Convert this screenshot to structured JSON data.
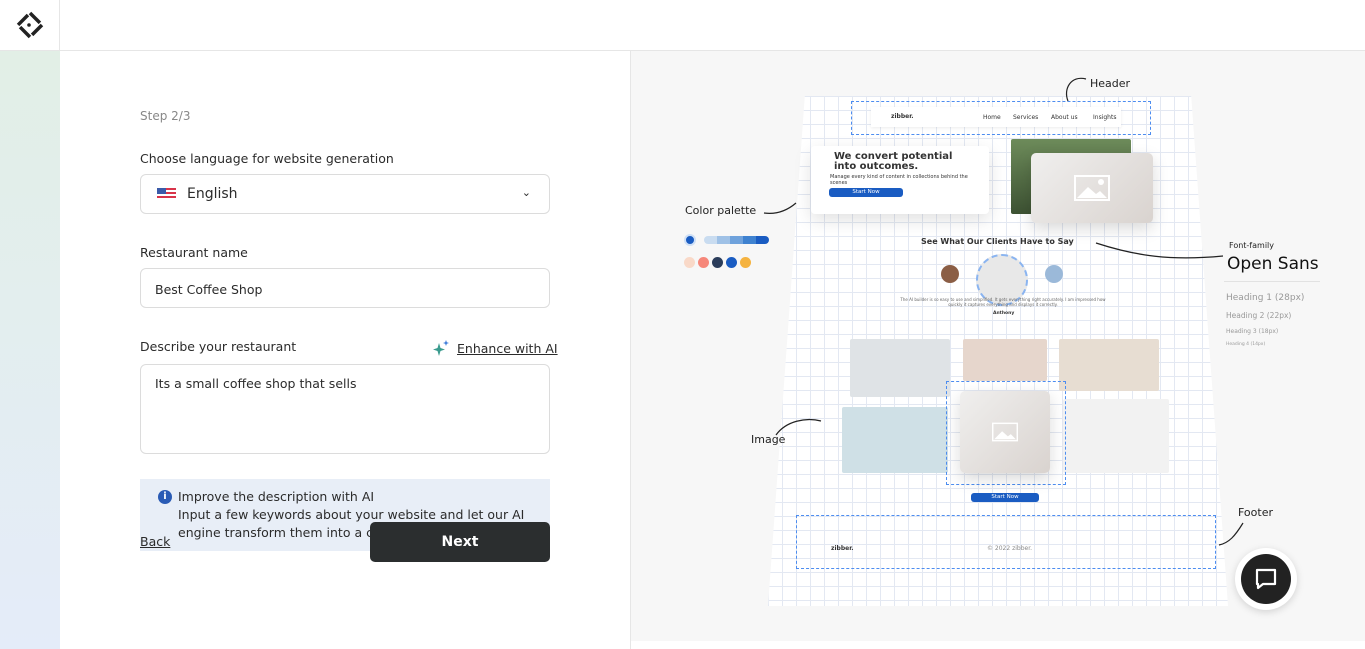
{
  "form": {
    "step": "Step 2/3",
    "language_label": "Choose language for website generation",
    "language_value": "English",
    "name_label": "Restaurant name",
    "name_value": "Best Coffee Shop",
    "desc_label": "Describe your restaurant",
    "enhance_label": "Enhance with AI",
    "desc_value": "Its a small coffee shop that sells",
    "info_title": "Improve the description with AI",
    "info_text": "Input a few keywords about your website and let our AI engine transform them into a compelling",
    "back_label": "Back",
    "next_label": "Next"
  },
  "preview": {
    "header_label": "Header",
    "color_palette_label": "Color palette",
    "font_family_label": "Font-family",
    "font_family_value": "Open Sans",
    "headings": [
      "Heading 1 (28px)",
      "Heading 2 (22px)",
      "Heading 3 (18px)",
      "Heading 4 (14px)"
    ],
    "image_label": "Image",
    "footer_label": "Footer",
    "mock": {
      "brand": "zibber.",
      "nav": [
        "Home",
        "Services",
        "About us",
        "Insights"
      ],
      "hero_title": "We convert potential into outcomes.",
      "hero_sub": "Manage every kind of content in collections behind the scenes",
      "cta": "Start Now",
      "testimonials_title": "See What Our Clients Have to Say",
      "testimonial": "The AI builder is so easy to use and simplified. It gets everything right accurately. I am impressed how quickly it captures everything and displays it correctly.",
      "author": "Anthony",
      "footer_copy": "© 2022 zibber."
    },
    "palette_colors": [
      "#f9d9c8",
      "#f6877a",
      "#2b3d5b",
      "#1a5cc2",
      "#f5b340"
    ],
    "shade_colors": [
      "#c9dcf0",
      "#9fc1e6",
      "#6fa2dc",
      "#3f82d0",
      "#1a5cc2"
    ]
  },
  "colors": {
    "next_bg": "#2b2e2f",
    "info_bg": "#e8eef7",
    "accent": "#1a5cc2"
  }
}
